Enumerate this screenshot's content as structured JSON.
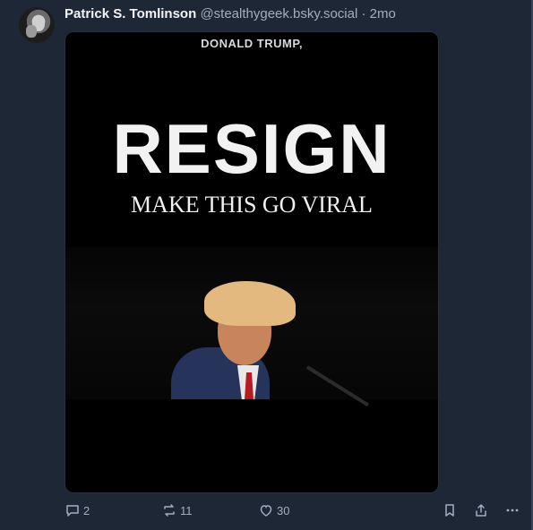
{
  "post": {
    "author_name": "Patrick S. Tomlinson",
    "author_handle": "@stealthygeek.bsky.social",
    "time": "· 2mo"
  },
  "media": {
    "top_text": "DONALD TRUMP,",
    "main_text": "RESIGN",
    "sub_text": "MAKE THIS GO VIRAL"
  },
  "actions": {
    "reply_count": "2",
    "repost_count": "11",
    "like_count": "30"
  },
  "icons": [
    "reply-icon",
    "repost-icon",
    "like-icon",
    "bookmark-icon",
    "share-icon",
    "more-icon"
  ],
  "colors": {
    "background": "#1e2736",
    "muted": "#a3adbd",
    "name": "#f3f4f6"
  }
}
